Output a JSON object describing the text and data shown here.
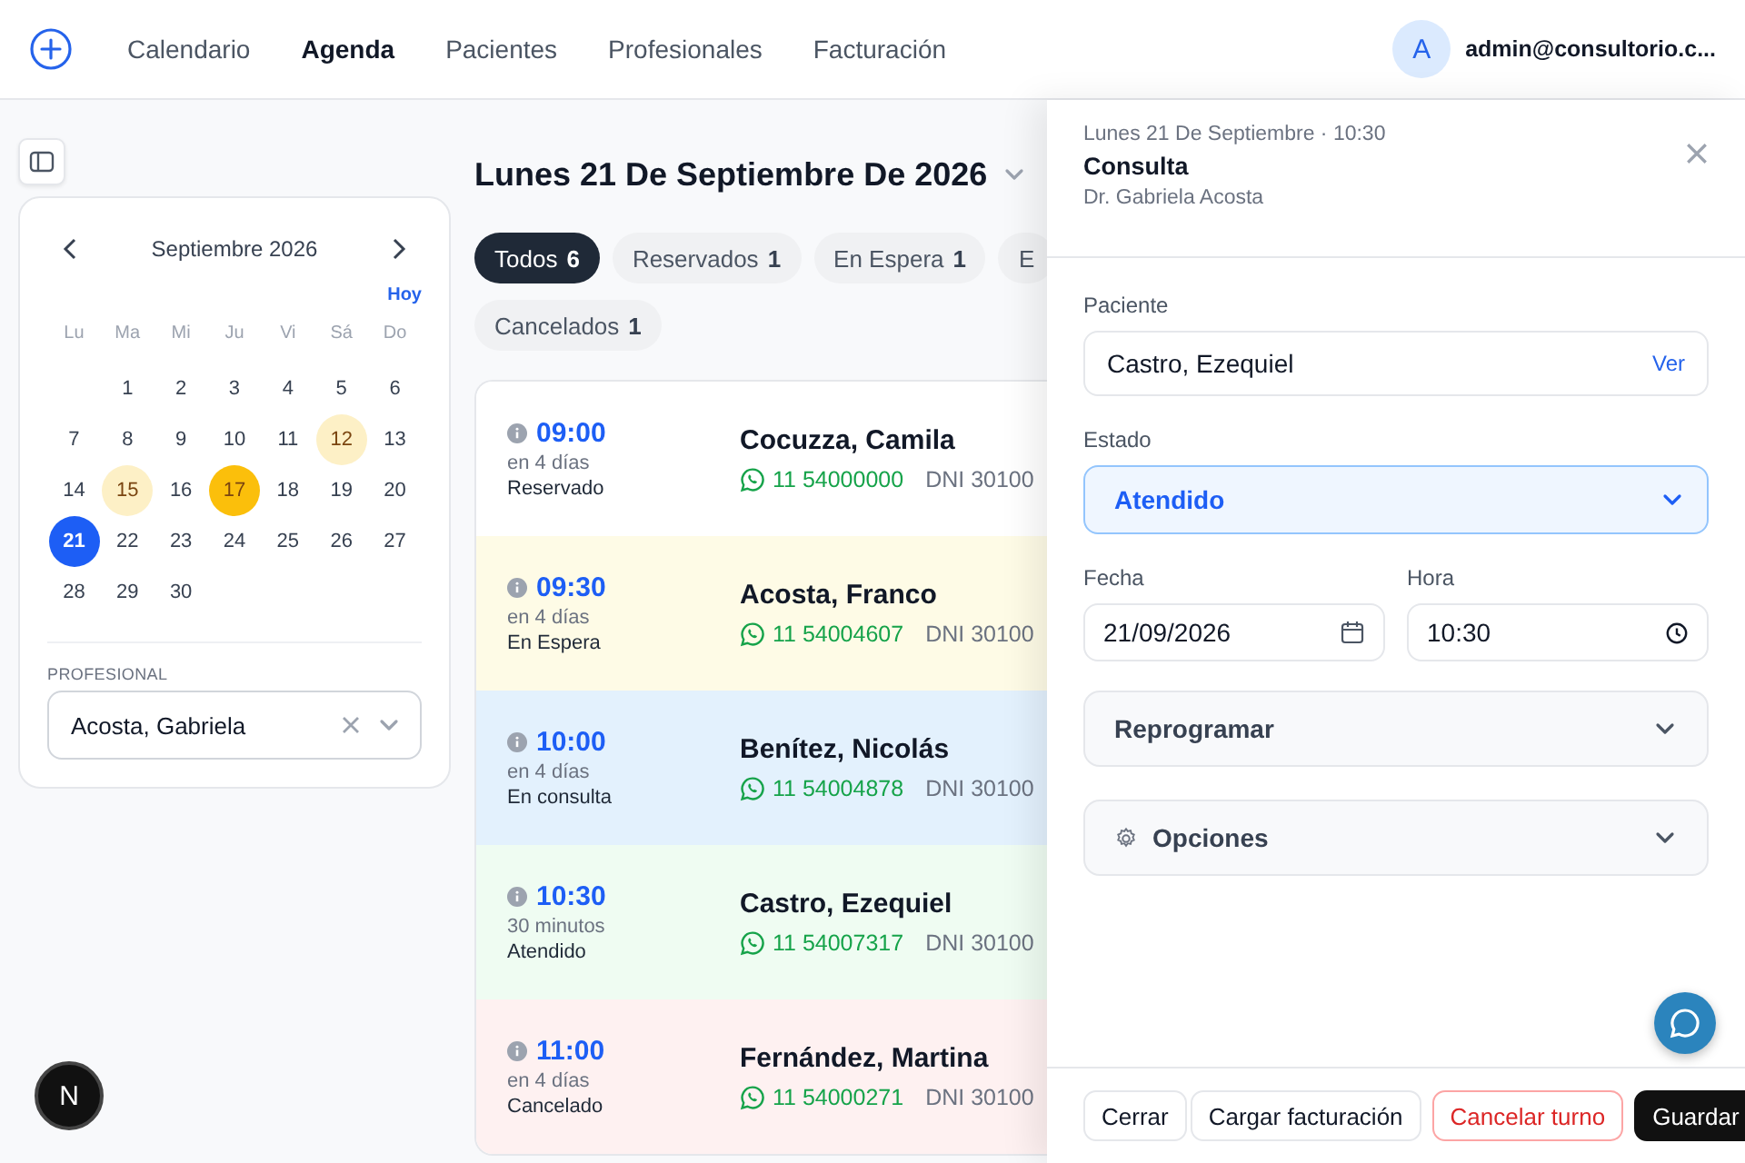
{
  "topbar": {
    "nav": [
      {
        "label": "Calendario",
        "selected": false
      },
      {
        "label": "Agenda",
        "selected": true
      },
      {
        "label": "Pacientes",
        "selected": false
      },
      {
        "label": "Profesionales",
        "selected": false
      },
      {
        "label": "Facturación",
        "selected": false
      }
    ],
    "avatar": "A",
    "user": "admin@consultorio.c..."
  },
  "calendar": {
    "month": "Septiembre 2026",
    "today": "Hoy",
    "weekdays": [
      "Lu",
      "Ma",
      "Mi",
      "Ju",
      "Vi",
      "Sá",
      "Do"
    ],
    "weeks": [
      [
        {
          "day": "1",
          "selected": false
        },
        {
          "day": "2",
          "selected": false
        },
        {
          "day": "3",
          "selected": false
        },
        {
          "day": "4",
          "selected": false
        },
        {
          "day": "5",
          "selected": false
        },
        {
          "day": "6",
          "selected": false
        }
      ],
      [
        {
          "day": "7",
          "selected": false
        },
        {
          "day": "8",
          "selected": false
        },
        {
          "day": "9",
          "selected": false
        },
        {
          "day": "10",
          "selected": false
        },
        {
          "day": "11",
          "selected": false
        },
        {
          "day": "12",
          "selected": false,
          "color": "#fdf0c6"
        },
        {
          "day": "13",
          "selected": false
        }
      ],
      [
        {
          "day": "14",
          "selected": false
        },
        {
          "day": "15",
          "selected": false,
          "color": "#fdf0c6"
        },
        {
          "day": "16",
          "selected": false
        },
        {
          "day": "17",
          "selected": false,
          "color": "#fbbf0b"
        },
        {
          "day": "18",
          "selected": false
        },
        {
          "day": "19",
          "selected": false
        },
        {
          "day": "20",
          "selected": false
        }
      ],
      [
        {
          "day": "21",
          "selected": true
        },
        {
          "day": "22",
          "selected": false
        },
        {
          "day": "23",
          "selected": false
        },
        {
          "day": "24",
          "selected": false
        },
        {
          "day": "25",
          "selected": false
        },
        {
          "day": "26",
          "selected": false
        },
        {
          "day": "27",
          "selected": false
        }
      ],
      [
        {
          "day": "28",
          "selected": false
        },
        {
          "day": "29",
          "selected": false
        },
        {
          "day": "30",
          "selected": false
        }
      ]
    ],
    "professional_label": "PROFESIONAL",
    "professional": "Acosta, Gabriela"
  },
  "agenda": {
    "title": "Lunes 21 De Septiembre De 2026",
    "filters": [
      {
        "label": "Todos",
        "count": "6",
        "selected": true
      },
      {
        "label": "Reservados",
        "count": "1",
        "selected": false
      },
      {
        "label": "En Espera",
        "count": "1",
        "selected": false
      },
      {
        "label": "E",
        "selected": false
      },
      {
        "label": "Cancelados",
        "count": "1",
        "selected": false
      }
    ],
    "appointments": [
      {
        "time": "09:00",
        "relative": "en 4 días",
        "status": "Reservado",
        "patient": "Cocuzza, Camila",
        "phone": "11 54000000",
        "dni": "DNI 30100",
        "color": "#ffffff"
      },
      {
        "time": "09:30",
        "relative": "en 4 días",
        "status": "En Espera",
        "patient": "Acosta, Franco",
        "phone": "11 54004607",
        "dni": "DNI 30100",
        "color": "#fefbe6"
      },
      {
        "time": "10:00",
        "relative": "en 4 días",
        "status": "En consulta",
        "patient": "Benítez, Nicolás",
        "phone": "11 54004878",
        "dni": "DNI 30100",
        "color": "#e3f1fd"
      },
      {
        "time": "10:30",
        "relative": "30 minutos",
        "status": "Atendido",
        "patient": "Castro, Ezequiel",
        "phone": "11 54007317",
        "dni": "DNI 30100",
        "color": "#effcf2"
      },
      {
        "time": "11:00",
        "relative": "en 4 días",
        "status": "Cancelado",
        "patient": "Fernández, Martina",
        "phone": "11 54000271",
        "dni": "DNI 30100",
        "color": "#fef1f1"
      }
    ]
  },
  "drawer": {
    "when": "Lunes 21 De Septiembre · 10:30",
    "title": "Consulta",
    "doctor": "Dr. Gabriela Acosta",
    "patient_label": "Paciente",
    "patient": "Castro, Ezequiel",
    "patient_link": "Ver",
    "status_label": "Estado",
    "status": "Atendido",
    "date_label": "Fecha",
    "date": "21/09/2026",
    "time_label": "Hora",
    "time": "10:30",
    "sections": [
      {
        "label": "Reprogramar",
        "kind": "plain",
        "expanded": false
      },
      {
        "label": "Opciones",
        "kind": "settings",
        "expanded": false
      }
    ],
    "buttons": [
      {
        "label": "Cerrar",
        "kind": "default"
      },
      {
        "label": "Cargar facturación",
        "kind": "default"
      },
      {
        "label": "Cancelar turno",
        "kind": "danger"
      },
      {
        "label": "Guardar",
        "kind": "primary"
      }
    ]
  },
  "dev_badge": "N"
}
